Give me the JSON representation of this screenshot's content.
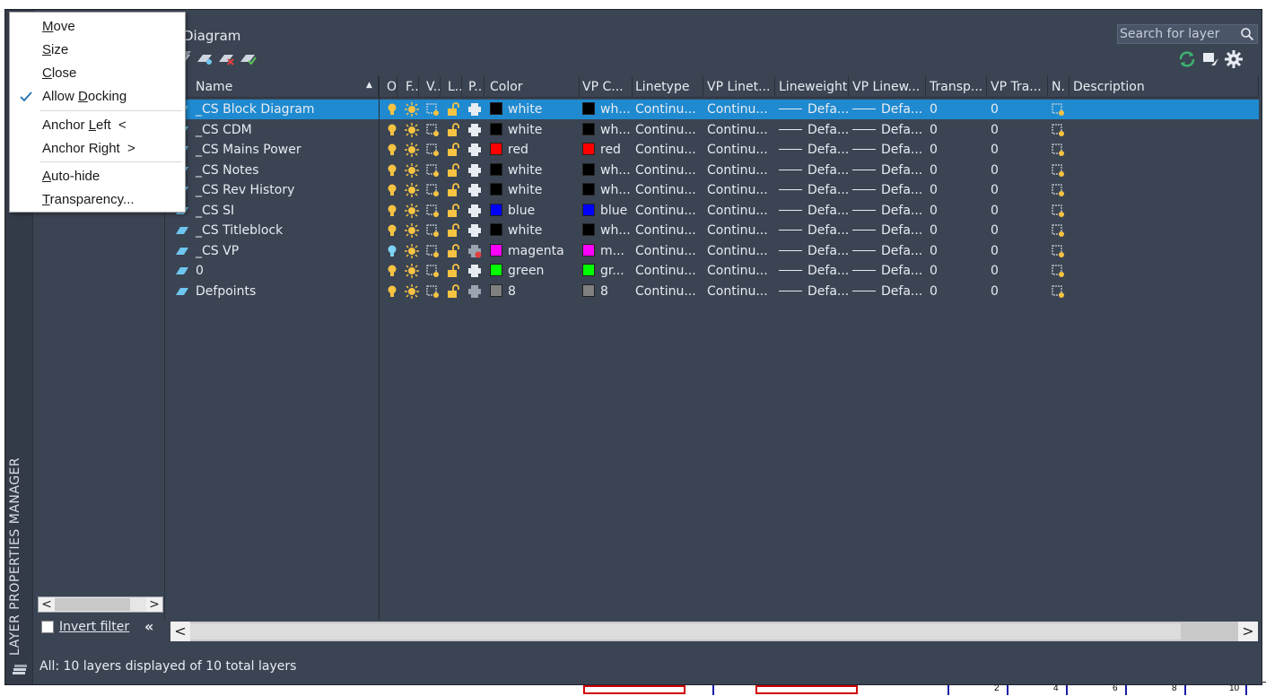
{
  "palette": {
    "side_title": "LAYER PROPERTIES MANAGER",
    "title": "Diagram",
    "search": {
      "placeholder": "Search for layer"
    },
    "invert_filter_label": "Invert filter",
    "collapse_label": "«",
    "status": "All: 10 layers displayed of 10 total layers"
  },
  "columns": [
    {
      "key": "name",
      "label": "Name"
    },
    {
      "key": "on",
      "label": "O."
    },
    {
      "key": "freeze",
      "label": "F.."
    },
    {
      "key": "vp",
      "label": "V.."
    },
    {
      "key": "lock",
      "label": "L.."
    },
    {
      "key": "plot",
      "label": "P.."
    },
    {
      "key": "color",
      "label": "Color"
    },
    {
      "key": "vpcolor",
      "label": "VP C..."
    },
    {
      "key": "linetype",
      "label": "Linetype"
    },
    {
      "key": "vplinetype",
      "label": "VP Linet..."
    },
    {
      "key": "lineweight",
      "label": "Lineweight"
    },
    {
      "key": "vplineweight",
      "label": "VP Linew..."
    },
    {
      "key": "transparency",
      "label": "Transp..."
    },
    {
      "key": "vptransparency",
      "label": "VP Tra..."
    },
    {
      "key": "newvp",
      "label": "N."
    },
    {
      "key": "description",
      "label": "Description"
    }
  ],
  "layers": [
    {
      "name": "_CS Block Diagram",
      "on_color": "#f6c342",
      "plot_disabled": false,
      "color": "white",
      "color_hex": "#000000",
      "vp_color": "wh...",
      "linetype": "Continu...",
      "vp_linetype": "Continu...",
      "lineweight": "Defa...",
      "vp_lineweight": "Defa...",
      "transparency": "0",
      "vp_transparency": "0"
    },
    {
      "name": "_CS CDM",
      "on_color": "#f6c342",
      "plot_disabled": false,
      "color": "white",
      "color_hex": "#000000",
      "vp_color": "wh...",
      "linetype": "Continu...",
      "vp_linetype": "Continu...",
      "lineweight": "Defa...",
      "vp_lineweight": "Defa...",
      "transparency": "0",
      "vp_transparency": "0"
    },
    {
      "name": "_CS Mains Power",
      "on_color": "#f6c342",
      "plot_disabled": false,
      "color": "red",
      "color_hex": "#ff0000",
      "vp_color": "red",
      "linetype": "Continu...",
      "vp_linetype": "Continu...",
      "lineweight": "Defa...",
      "vp_lineweight": "Defa...",
      "transparency": "0",
      "vp_transparency": "0"
    },
    {
      "name": "_CS Notes",
      "on_color": "#f6c342",
      "plot_disabled": false,
      "color": "white",
      "color_hex": "#000000",
      "vp_color": "wh...",
      "linetype": "Continu...",
      "vp_linetype": "Continu...",
      "lineweight": "Defa...",
      "vp_lineweight": "Defa...",
      "transparency": "0",
      "vp_transparency": "0"
    },
    {
      "name": "_CS Rev History",
      "on_color": "#f6c342",
      "plot_disabled": false,
      "color": "white",
      "color_hex": "#000000",
      "vp_color": "wh...",
      "linetype": "Continu...",
      "vp_linetype": "Continu...",
      "lineweight": "Defa...",
      "vp_lineweight": "Defa...",
      "transparency": "0",
      "vp_transparency": "0"
    },
    {
      "name": "_CS SI",
      "on_color": "#f6c342",
      "plot_disabled": false,
      "color": "blue",
      "color_hex": "#0000ff",
      "vp_color": "blue",
      "linetype": "Continu...",
      "vp_linetype": "Continu...",
      "lineweight": "Defa...",
      "vp_lineweight": "Defa...",
      "transparency": "0",
      "vp_transparency": "0"
    },
    {
      "name": "_CS Titleblock",
      "on_color": "#f6c342",
      "plot_disabled": false,
      "color": "white",
      "color_hex": "#000000",
      "vp_color": "wh...",
      "linetype": "Continu...",
      "vp_linetype": "Continu...",
      "lineweight": "Defa...",
      "vp_lineweight": "Defa...",
      "transparency": "0",
      "vp_transparency": "0"
    },
    {
      "name": "_CS VP",
      "on_color": "#7fd3f5",
      "plot_disabled": true,
      "color": "magenta",
      "color_hex": "#ff00ff",
      "vp_color": "m...",
      "linetype": "Continu...",
      "vp_linetype": "Continu...",
      "lineweight": "Defa...",
      "vp_lineweight": "Defa...",
      "transparency": "0",
      "vp_transparency": "0"
    },
    {
      "name": "0",
      "on_color": "#f6c342",
      "plot_disabled": false,
      "color": "green",
      "color_hex": "#00ff00",
      "vp_color": "gr...",
      "linetype": "Continu...",
      "vp_linetype": "Continu...",
      "lineweight": "Defa...",
      "vp_lineweight": "Defa...",
      "transparency": "0",
      "vp_transparency": "0"
    },
    {
      "name": "Defpoints",
      "on_color": "#f6c342",
      "plot_disabled": true,
      "color": "8",
      "color_hex": "#808080",
      "vp_color": "8",
      "linetype": "Continu...",
      "vp_linetype": "Continu...",
      "lineweight": "Defa...",
      "vp_lineweight": "Defa...",
      "transparency": "0",
      "vp_transparency": "0"
    }
  ],
  "selected_row": 0,
  "context_menu": {
    "items": [
      {
        "pre": "",
        "ul": "M",
        "post": "ove",
        "checked": false
      },
      {
        "pre": "",
        "ul": "S",
        "post": "ize",
        "checked": false
      },
      {
        "pre": "",
        "ul": "C",
        "post": "lose",
        "checked": false
      },
      {
        "pre": "Allow ",
        "ul": "D",
        "post": "ocking",
        "checked": true
      },
      {
        "pre": "Anchor ",
        "ul": "L",
        "post": "eft  <",
        "checked": false
      },
      {
        "pre": "Anchor Ri",
        "ul": "g",
        "post": "ht  >",
        "checked": false
      },
      {
        "pre": "",
        "ul": "A",
        "post": "uto-hide",
        "checked": false
      },
      {
        "pre": "",
        "ul": "T",
        "post": "ransparency...",
        "checked": false
      }
    ]
  },
  "drawing_numbers": [
    "2",
    "4",
    "6",
    "8",
    "10"
  ],
  "colors": {
    "selection": "#1f8ad0",
    "panel": "#3b4453",
    "accent_green": "#3cb371"
  }
}
